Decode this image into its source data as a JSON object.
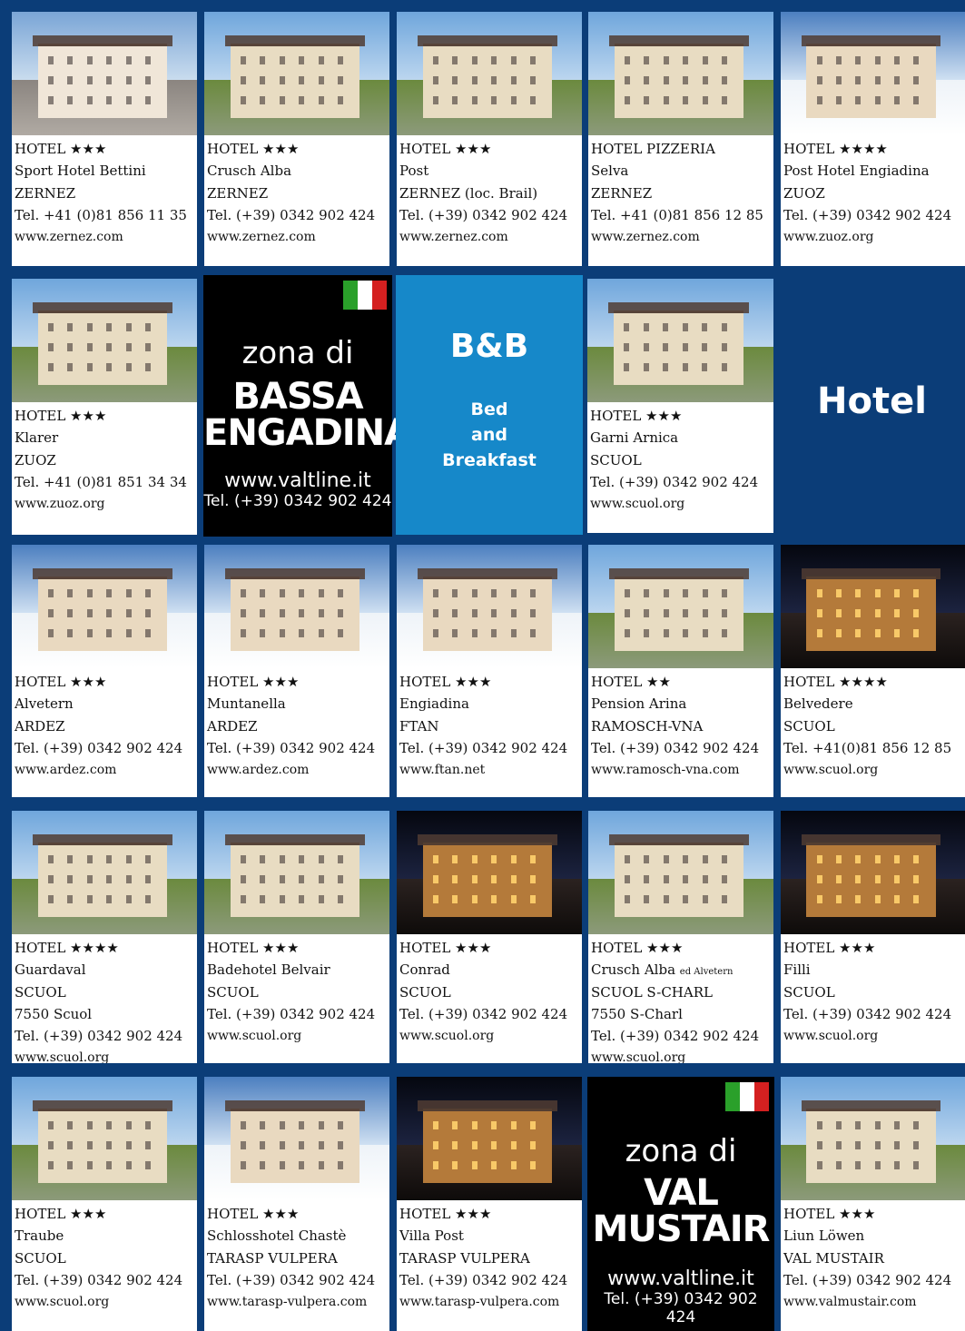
{
  "colors": {
    "navy": "#0b3d78",
    "bb_blue": "#1688c9",
    "flag_green": "#2aa02a",
    "flag_white": "#ffffff",
    "flag_red": "#d42020"
  },
  "hotels": [
    {
      "id": "c1",
      "stars": "HOTEL ★★★",
      "name": "Sport Hotel Bettini",
      "place": "ZERNEZ",
      "tel": "Tel. +41 (0)81 856 11 35",
      "web": "www.zernez.com",
      "scene": "town"
    },
    {
      "id": "c2",
      "stars": "HOTEL ★★★",
      "name": "Crusch Alba",
      "place": "ZERNEZ",
      "tel": "Tel. (+39) 0342 902 424",
      "web": "www.zernez.com",
      "scene": "summer"
    },
    {
      "id": "c3",
      "stars": "HOTEL ★★★",
      "name": "Post",
      "place": "ZERNEZ (loc. Brail)",
      "tel": "Tel. (+39) 0342 902 424",
      "web": "www.zernez.com",
      "scene": "summer"
    },
    {
      "id": "c4",
      "stars": "HOTEL PIZZERIA",
      "name": "Selva",
      "place": "ZERNEZ",
      "tel": "Tel. +41 (0)81 856 12 85",
      "web": "www.zernez.com",
      "scene": "summer"
    },
    {
      "id": "c5",
      "stars": "HOTEL ★★★★",
      "name": "Post Hotel Engiadina",
      "place": "ZUOZ",
      "tel": "Tel. (+39) 0342 902 424",
      "web": "www.zuoz.org",
      "scene": "winter"
    },
    {
      "id": "c6",
      "stars": "HOTEL ★★★",
      "name": "Klarer",
      "place": "ZUOZ",
      "tel": "Tel. +41 (0)81 851 34 34",
      "web": "www.zuoz.org",
      "scene": "summer"
    },
    {
      "id": "c9",
      "stars": "HOTEL ★★★",
      "name": "Garni Arnica",
      "place": "SCUOL",
      "tel": "Tel. (+39) 0342 902 424",
      "web": "www.scuol.org",
      "scene": "summer"
    },
    {
      "id": "c11",
      "stars": "HOTEL ★★★",
      "name": "Alvetern",
      "place": "ARDEZ",
      "tel": "Tel. (+39) 0342 902 424",
      "web": "www.ardez.com",
      "scene": "winter"
    },
    {
      "id": "c12",
      "stars": "HOTEL ★★★",
      "name": "Muntanella",
      "place": "ARDEZ",
      "tel": "Tel. (+39) 0342 902 424",
      "web": "www.ardez.com",
      "scene": "winter"
    },
    {
      "id": "c13",
      "stars": "HOTEL ★★★",
      "name": "Engiadina",
      "place": "FTAN",
      "tel": "Tel. (+39) 0342 902 424",
      "web": "www.ftan.net",
      "scene": "winter"
    },
    {
      "id": "c14",
      "stars": "HOTEL ★★",
      "name": "Pension Arina",
      "place": "RAMOSCH-VNA",
      "tel": "Tel. (+39) 0342 902 424",
      "web": "www.ramosch-vna.com",
      "scene": "summer"
    },
    {
      "id": "c15",
      "stars": "HOTEL ★★★★",
      "name": "Belvedere",
      "place": "SCUOL",
      "tel": "Tel. +41(0)81 856 12 85",
      "web": "www.scuol.org",
      "scene": "night"
    },
    {
      "id": "c16",
      "stars": "HOTEL ★★★★",
      "name": "Guardaval",
      "place": "SCUOL",
      "extra": "7550 Scuol",
      "tel": "Tel. (+39) 0342 902 424",
      "web": "www.scuol.org",
      "scene": "summer"
    },
    {
      "id": "c17",
      "stars": "HOTEL ★★★",
      "name": "Badehotel Belvair",
      "place": "SCUOL",
      "tel": "Tel. (+39) 0342 902 424",
      "web": "www.scuol.org",
      "scene": "summer"
    },
    {
      "id": "c18",
      "stars": "HOTEL ★★★",
      "name": "Conrad",
      "place": "SCUOL",
      "tel": "Tel. (+39) 0342 902 424",
      "web": "www.scuol.org",
      "scene": "night"
    },
    {
      "id": "c19",
      "stars": "HOTEL ★★★",
      "name": "Crusch Alba",
      "name_suffix": "ed Alvetern",
      "place": "SCUOL S-CHARL",
      "extra": "7550 S-Charl",
      "tel": "Tel. (+39) 0342 902 424",
      "web": "www.scuol.org",
      "scene": "summer"
    },
    {
      "id": "c20",
      "stars": "HOTEL ★★★",
      "name": "Filli",
      "place": "SCUOL",
      "tel": "Tel. (+39) 0342 902 424",
      "web": "www.scuol.org",
      "scene": "night"
    },
    {
      "id": "c21",
      "stars": "HOTEL ★★★",
      "name": "Traube",
      "place": "SCUOL",
      "tel": "Tel. (+39) 0342 902 424",
      "web": "www.scuol.org",
      "scene": "summer"
    },
    {
      "id": "c22",
      "stars": "HOTEL ★★★",
      "name": "Schlosshotel Chastè",
      "place": "TARASP VULPERA",
      "tel": "Tel. (+39) 0342 902 424",
      "web": "www.tarasp-vulpera.com",
      "scene": "winter"
    },
    {
      "id": "c23",
      "stars": "HOTEL ★★★",
      "name": "Villa Post",
      "place": "TARASP VULPERA",
      "tel": "Tel. (+39) 0342 902 424",
      "web": "www.tarasp-vulpera.com",
      "scene": "night"
    },
    {
      "id": "c25",
      "stars": "HOTEL ★★★",
      "name": "Liun Löwen",
      "place": "VAL MUSTAIR",
      "tel": "Tel. (+39) 0342 902 424",
      "web": "www.valmustair.com",
      "scene": "summer"
    }
  ],
  "zona_bassa": {
    "line1": "zona di",
    "line2": "BASSA",
    "line3": "ENGADINA",
    "web": "www.valtline.it",
    "tel": "Tel. (+39) 0342 902 424"
  },
  "zona_val": {
    "line1": "zona di",
    "line2": "VAL",
    "line3": "MUSTAIR",
    "web": "www.valtline.it",
    "tel": "Tel. (+39) 0342 902 424"
  },
  "bb": {
    "title": "B&B",
    "line1": "Bed",
    "line2": "and",
    "line3": "Breakfast"
  },
  "hotel_label": "Hotel"
}
